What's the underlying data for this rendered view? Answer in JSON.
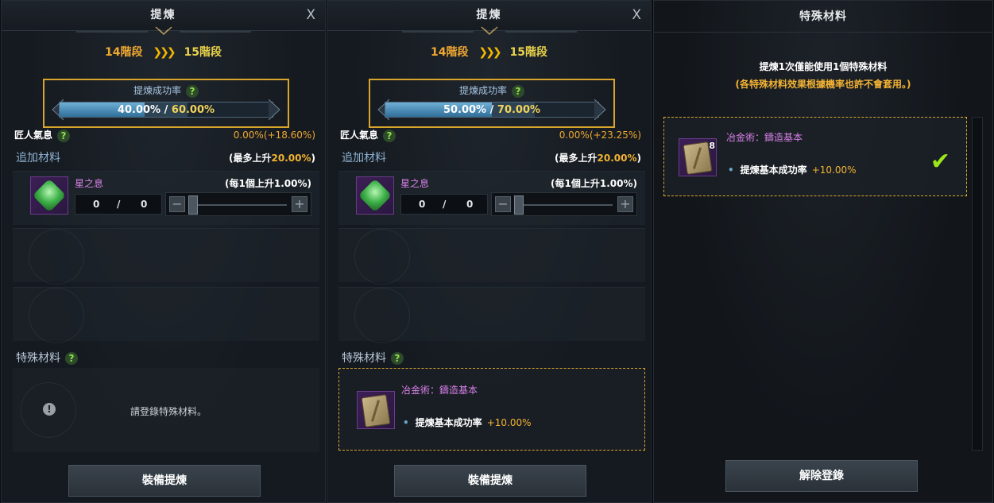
{
  "panels": [
    {
      "title": "提煉",
      "close": "X",
      "stage_from": "14階段",
      "stage_to": "15階段",
      "rate_label": "提煉成功率",
      "help": "?",
      "rate_current": "40.00%",
      "rate_max": "60.00%",
      "rate_current_fraction": 0.4,
      "rate_max_fraction": 0.6,
      "craft_label": "匠人氣息",
      "craft_value": "0.00%(+18.60%)",
      "add_title": "追加材料",
      "add_max_prefix": "(最多上升",
      "add_max_value": "20.00%",
      "add_max_suffix": ")",
      "mat_name": "星之息",
      "mat_per": "(每1個上升1.00%)",
      "count_have": "0",
      "count_sep": "/",
      "count_use": "0",
      "special_title": "特殊材料",
      "special_hint": "請登錄特殊材料。",
      "action": "裝備提煉"
    },
    {
      "title": "提煉",
      "close": "X",
      "stage_from": "14階段",
      "stage_to": "15階段",
      "rate_label": "提煉成功率",
      "help": "?",
      "rate_current": "50.00%",
      "rate_max": "70.00%",
      "rate_current_fraction": 0.5,
      "rate_max_fraction": 0.7,
      "craft_label": "匠人氣息",
      "craft_value": "0.00%(+23.25%)",
      "add_title": "追加材料",
      "add_max_prefix": "(最多上升",
      "add_max_value": "20.00%",
      "add_max_suffix": ")",
      "mat_name": "星之息",
      "mat_per": "(每1個上升1.00%)",
      "count_have": "0",
      "count_sep": "/",
      "count_use": "0",
      "special_title": "特殊材料",
      "special_item_name": "冶金術：鑄造基本",
      "special_item_effect": "提煉基本成功率",
      "special_item_value": "+10.00%",
      "action": "裝備提煉"
    }
  ],
  "special_panel": {
    "title": "特殊材料",
    "notice": "提煉1次僅能使用1個特殊材料",
    "sub_notice": "(各特殊材料效果根據機率也許不會套用。)",
    "item_name": "冶金術：鑄造基本",
    "item_qty": "8",
    "item_effect": "提煉基本成功率",
    "item_value": "+10.00%",
    "action": "解除登錄"
  },
  "colors": {
    "highlight_border": "#d9a52b",
    "stage_from": "#f0a830",
    "stage_to": "#e8d24a",
    "material_name": "#d880e8",
    "accent_value": "#f2b233",
    "check": "#9ae61a"
  },
  "icons": [
    "close-icon",
    "chevron-right-icon",
    "help-icon",
    "gem-icon",
    "minus-icon",
    "plus-icon",
    "warning-icon",
    "book-icon",
    "checkmark-icon"
  ]
}
